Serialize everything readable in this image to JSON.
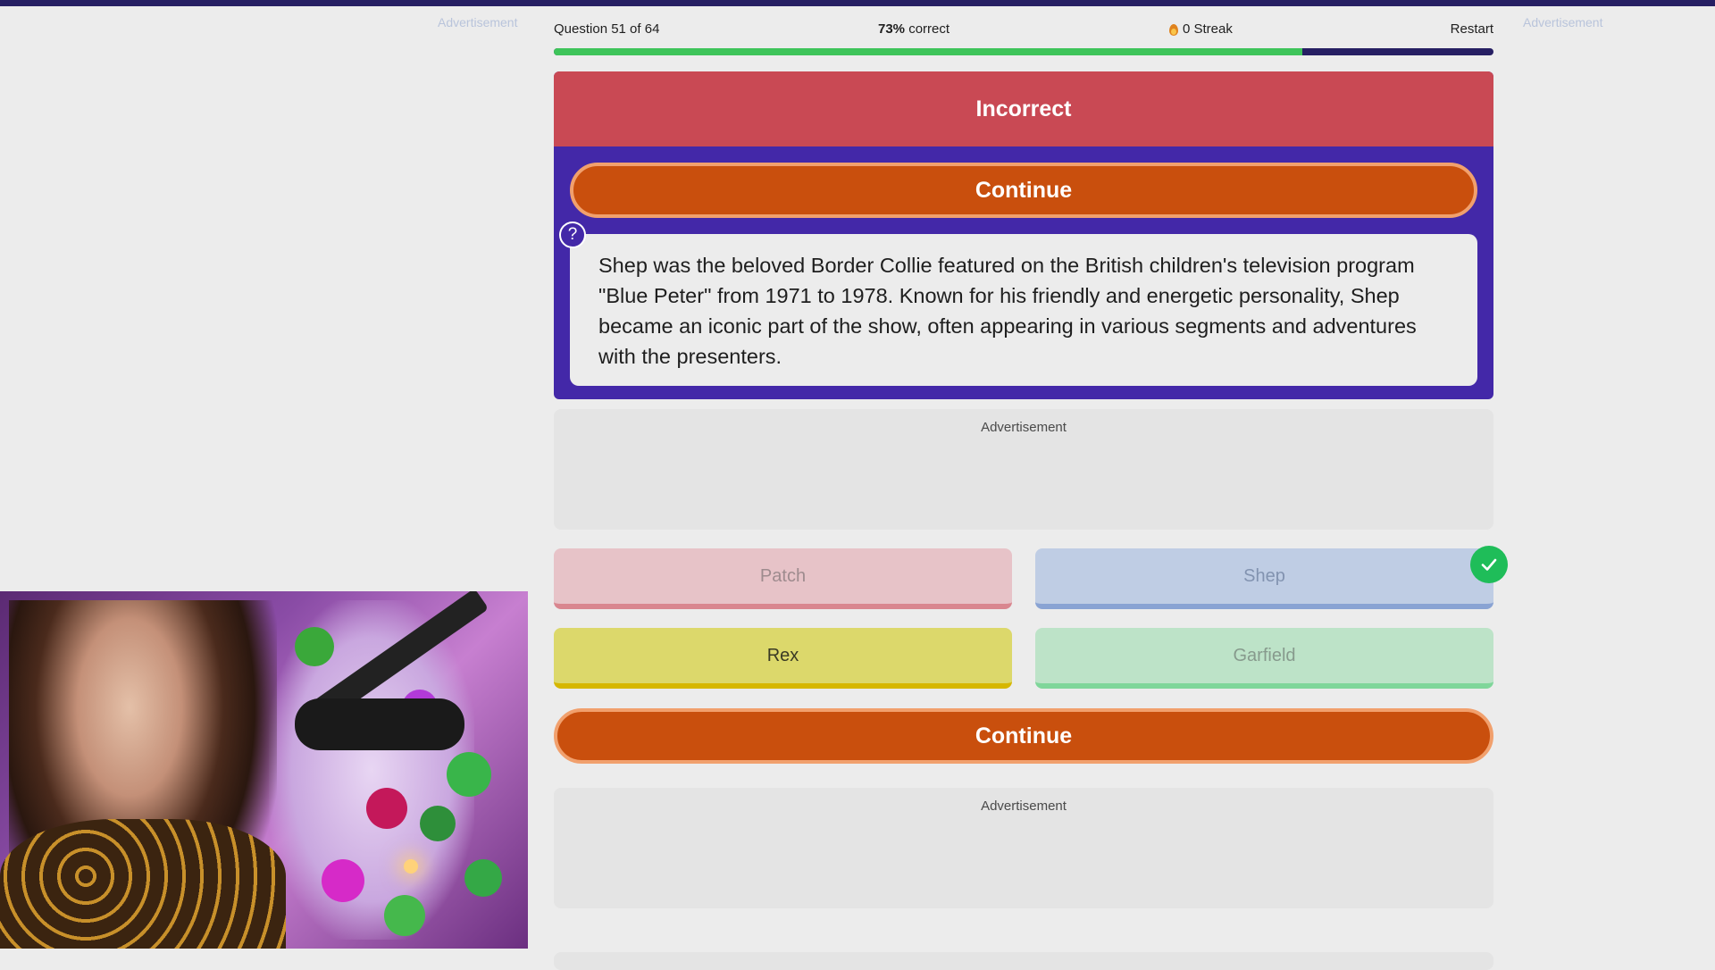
{
  "header": {
    "question_counter": "Question 51 of 64",
    "percent": "73%",
    "correct_word": "correct",
    "streak": "0 Streak",
    "restart": "Restart"
  },
  "side_ads": {
    "left": "Advertisement",
    "right": "Advertisement"
  },
  "progress": {
    "fraction": 0.797
  },
  "feedback": {
    "result": "Incorrect",
    "continue_label": "Continue",
    "help_icon": "?",
    "explanation": "Shep was the beloved Border Collie featured on the British children's television program \"Blue Peter\" from 1971 to 1978. Known for his friendly and energetic personality, Shep became an iconic part of the show, often appearing in various segments and adventures with the presenters."
  },
  "ads": {
    "middle": "Advertisement",
    "bottom": "Advertisement"
  },
  "answers": [
    {
      "label": "Patch"
    },
    {
      "label": "Shep"
    },
    {
      "label": "Rex"
    },
    {
      "label": "Garfield"
    }
  ],
  "correct_answer": "Shep",
  "continue_bottom_label": "Continue",
  "colors": {
    "top_bar": "#261f63",
    "incorrect_banner": "#c94954",
    "card": "#4328a8",
    "continue": "#c94f0d",
    "progress_fill": "#3ec45a",
    "check": "#1fbd59"
  },
  "icons": {
    "streak": "flame-icon",
    "help": "question-mark-icon",
    "correct": "checkmark-icon"
  }
}
